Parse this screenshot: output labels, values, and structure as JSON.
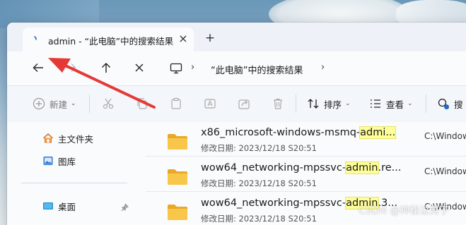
{
  "tab": {
    "title": "admin - “此电脑”中的搜索结果",
    "close_glyph": "×",
    "new_glyph": "+"
  },
  "address": {
    "path": "“此电脑”中的搜索结果",
    "chevron": "›"
  },
  "toolbar": {
    "new_label": "新建",
    "sort_label": "排序",
    "view_label": "查看",
    "search_label": "搜",
    "caret": "⌄"
  },
  "sidebar": {
    "items": [
      {
        "label": "主文件夹",
        "icon": "home-icon"
      },
      {
        "label": "图库",
        "icon": "gallery-icon"
      },
      {
        "label": "桌面",
        "icon": "desktop-icon"
      }
    ]
  },
  "results": [
    {
      "name_before": "x86_microsoft-windows-msmq-",
      "name_highlight": "admi...",
      "name_after": "",
      "modified": "修改日期: 2023/12/18 S20:51",
      "path": "C:\\Windows\\W"
    },
    {
      "name_before": "wow64_networking-mpssvc-",
      "name_highlight": "admin",
      "name_after": ".re...",
      "modified": "修改日期: 2023/12/18 S20:51",
      "path": "C:\\Windows\\W"
    },
    {
      "name_before": "wow64_networking-mpssvc-",
      "name_highlight": "admin",
      "name_after": ".3...",
      "modified": "修改日期: 2023/12/18 S20:51",
      "path": "C:\\Windows\\W"
    }
  ],
  "watermark": "CSDN @神秘泣男子",
  "colors": {
    "accent": "#2468c8",
    "highlight": "#ffff99",
    "arrow": "#e53935"
  }
}
